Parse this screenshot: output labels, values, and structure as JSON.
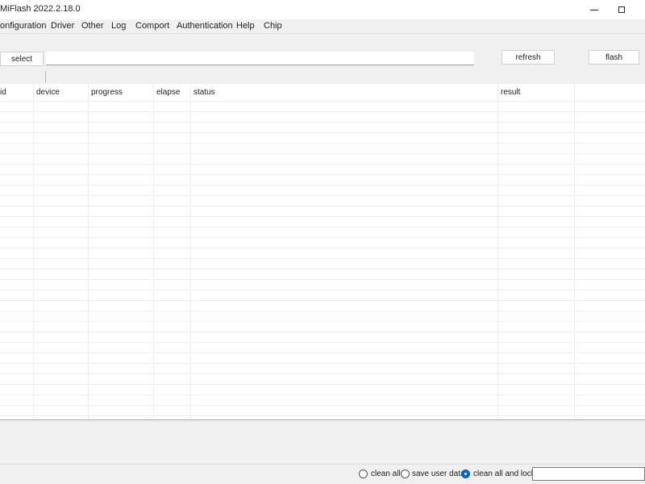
{
  "window": {
    "title": "MiFlash 2022.2.18.0",
    "minimize_icon": "minimize-icon",
    "maximize_icon": "maximize-icon"
  },
  "menu": {
    "items": [
      {
        "label": "onfiguration"
      },
      {
        "label": "Driver"
      },
      {
        "label": "Other"
      },
      {
        "label": "Log"
      },
      {
        "label": "Comport"
      },
      {
        "label": "Authentication"
      },
      {
        "label": "Help"
      },
      {
        "label": "Chip"
      }
    ]
  },
  "toolbar": {
    "select_label": "select",
    "path_value": "",
    "refresh_label": "refresh",
    "flash_label": "flash"
  },
  "table": {
    "columns": [
      "id",
      "device",
      "progress",
      "elapse",
      "status",
      "result"
    ],
    "rows": []
  },
  "options": {
    "clean_all": "clean all",
    "save_user_data": "save user data",
    "clean_all_and_lock": "clean all and lock",
    "selected": "clean all and lock"
  },
  "accent_color": "#0067c0"
}
